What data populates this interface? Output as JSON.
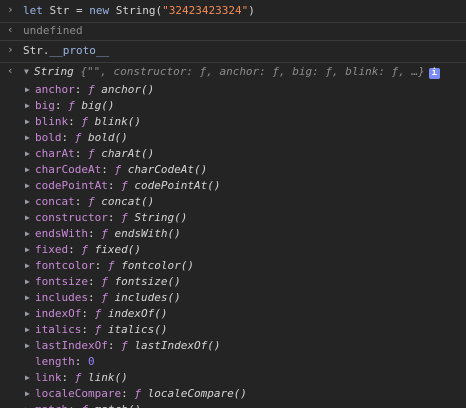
{
  "entries": [
    {
      "prompt": "let Str = new String(\"32423423324\")",
      "parts": {
        "let": "let",
        "var": " Str = ",
        "new": "new",
        "ctor": " String(",
        "arg": "\"32423423324\"",
        "close": ")"
      }
    },
    {
      "result": "undefined"
    },
    {
      "prompt_proto_a": "Str.",
      "prompt_proto_b": "__proto__"
    }
  ],
  "summary": {
    "type": "String",
    "text": " {\"\", constructor: ƒ, anchor: ƒ, big: ƒ, blink: ƒ, …}"
  },
  "properties": [
    {
      "key": "anchor",
      "fn": "anchor()"
    },
    {
      "key": "big",
      "fn": "big()"
    },
    {
      "key": "blink",
      "fn": "blink()"
    },
    {
      "key": "bold",
      "fn": "bold()"
    },
    {
      "key": "charAt",
      "fn": "charAt()"
    },
    {
      "key": "charCodeAt",
      "fn": "charCodeAt()"
    },
    {
      "key": "codePointAt",
      "fn": "codePointAt()"
    },
    {
      "key": "concat",
      "fn": "concat()"
    },
    {
      "key": "constructor",
      "fn": "String()"
    },
    {
      "key": "endsWith",
      "fn": "endsWith()"
    },
    {
      "key": "fixed",
      "fn": "fixed()"
    },
    {
      "key": "fontcolor",
      "fn": "fontcolor()"
    },
    {
      "key": "fontsize",
      "fn": "fontsize()"
    },
    {
      "key": "includes",
      "fn": "includes()"
    },
    {
      "key": "indexOf",
      "fn": "indexOf()"
    },
    {
      "key": "italics",
      "fn": "italics()"
    },
    {
      "key": "lastIndexOf",
      "fn": "lastIndexOf()"
    },
    {
      "key": "length",
      "value": "0"
    },
    {
      "key": "link",
      "fn": "link()"
    },
    {
      "key": "localeCompare",
      "fn": "localeCompare()"
    },
    {
      "key": "match",
      "fn": "match()"
    }
  ],
  "labels": {
    "f": "ƒ",
    "colon": ":",
    "info": "i"
  },
  "icons": {
    "prompt": "prompt-chevron-icon",
    "result": "result-arrow-icon",
    "expand": "expand-triangle-icon"
  }
}
